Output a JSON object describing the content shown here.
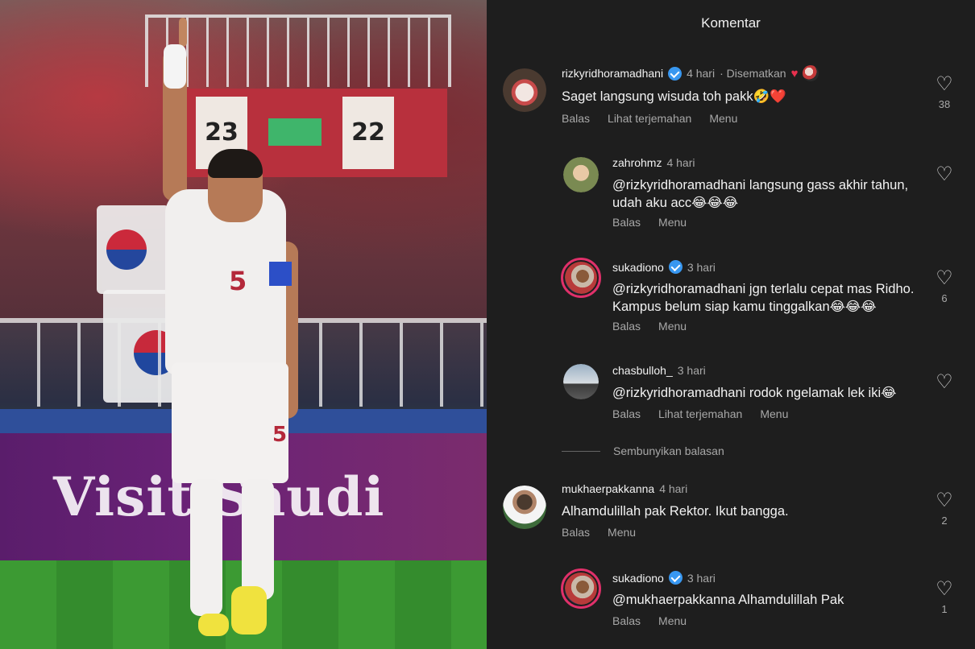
{
  "photo": {
    "stand_numbers": [
      "23",
      "22"
    ],
    "board_text": "Visit Saudi",
    "jersey_number": "5"
  },
  "header": {
    "title": "Komentar"
  },
  "comments": [
    {
      "user": "rizkyridhoramadhani",
      "verified": true,
      "time": "4 hari",
      "pinned_label": "· Disematkan",
      "text": "Saget langsung wisuda toh pakk🤣❤️",
      "actions": [
        "Balas",
        "Lihat terjemahan",
        "Menu"
      ],
      "likes": "38"
    },
    {
      "user": "zahrohmz",
      "verified": false,
      "time": "4 hari",
      "text": "@rizkyridhoramadhani langsung gass akhir tahun, udah aku acc😂😂😂",
      "actions": [
        "Balas",
        "Menu"
      ],
      "likes": ""
    },
    {
      "user": "sukadiono",
      "verified": true,
      "time": "3 hari",
      "text": "@rizkyridhoramadhani jgn terlalu cepat mas Ridho. Kampus belum siap kamu tinggalkan😂😂😂",
      "actions": [
        "Balas",
        "Menu"
      ],
      "likes": "6"
    },
    {
      "user": "chasbulloh_",
      "verified": false,
      "time": "3 hari",
      "text": "@rizkyridhoramadhani rodok ngelamak lek iki😂",
      "actions": [
        "Balas",
        "Lihat terjemahan",
        "Menu"
      ],
      "likes": ""
    },
    {
      "user": "mukhaerpakkanna",
      "verified": false,
      "time": "4 hari",
      "text": "Alhamdulillah pak Rektor.  Ikut bangga.",
      "actions": [
        "Balas",
        "Menu"
      ],
      "likes": "2"
    },
    {
      "user": "sukadiono",
      "verified": true,
      "time": "3 hari",
      "text": "@mukhaerpakkanna Alhamdulillah Pak",
      "actions": [
        "Balas",
        "Menu"
      ],
      "likes": "1"
    }
  ],
  "hide_replies_label": "Sembunyikan balasan",
  "colors": {
    "background": "#1e1e1e",
    "verified": "#3897f0",
    "heart_red": "#e8304e",
    "muted_text": "#a8a8a8"
  },
  "icons": {
    "like": "heart-outline-icon",
    "verified": "verified-badge-icon"
  }
}
